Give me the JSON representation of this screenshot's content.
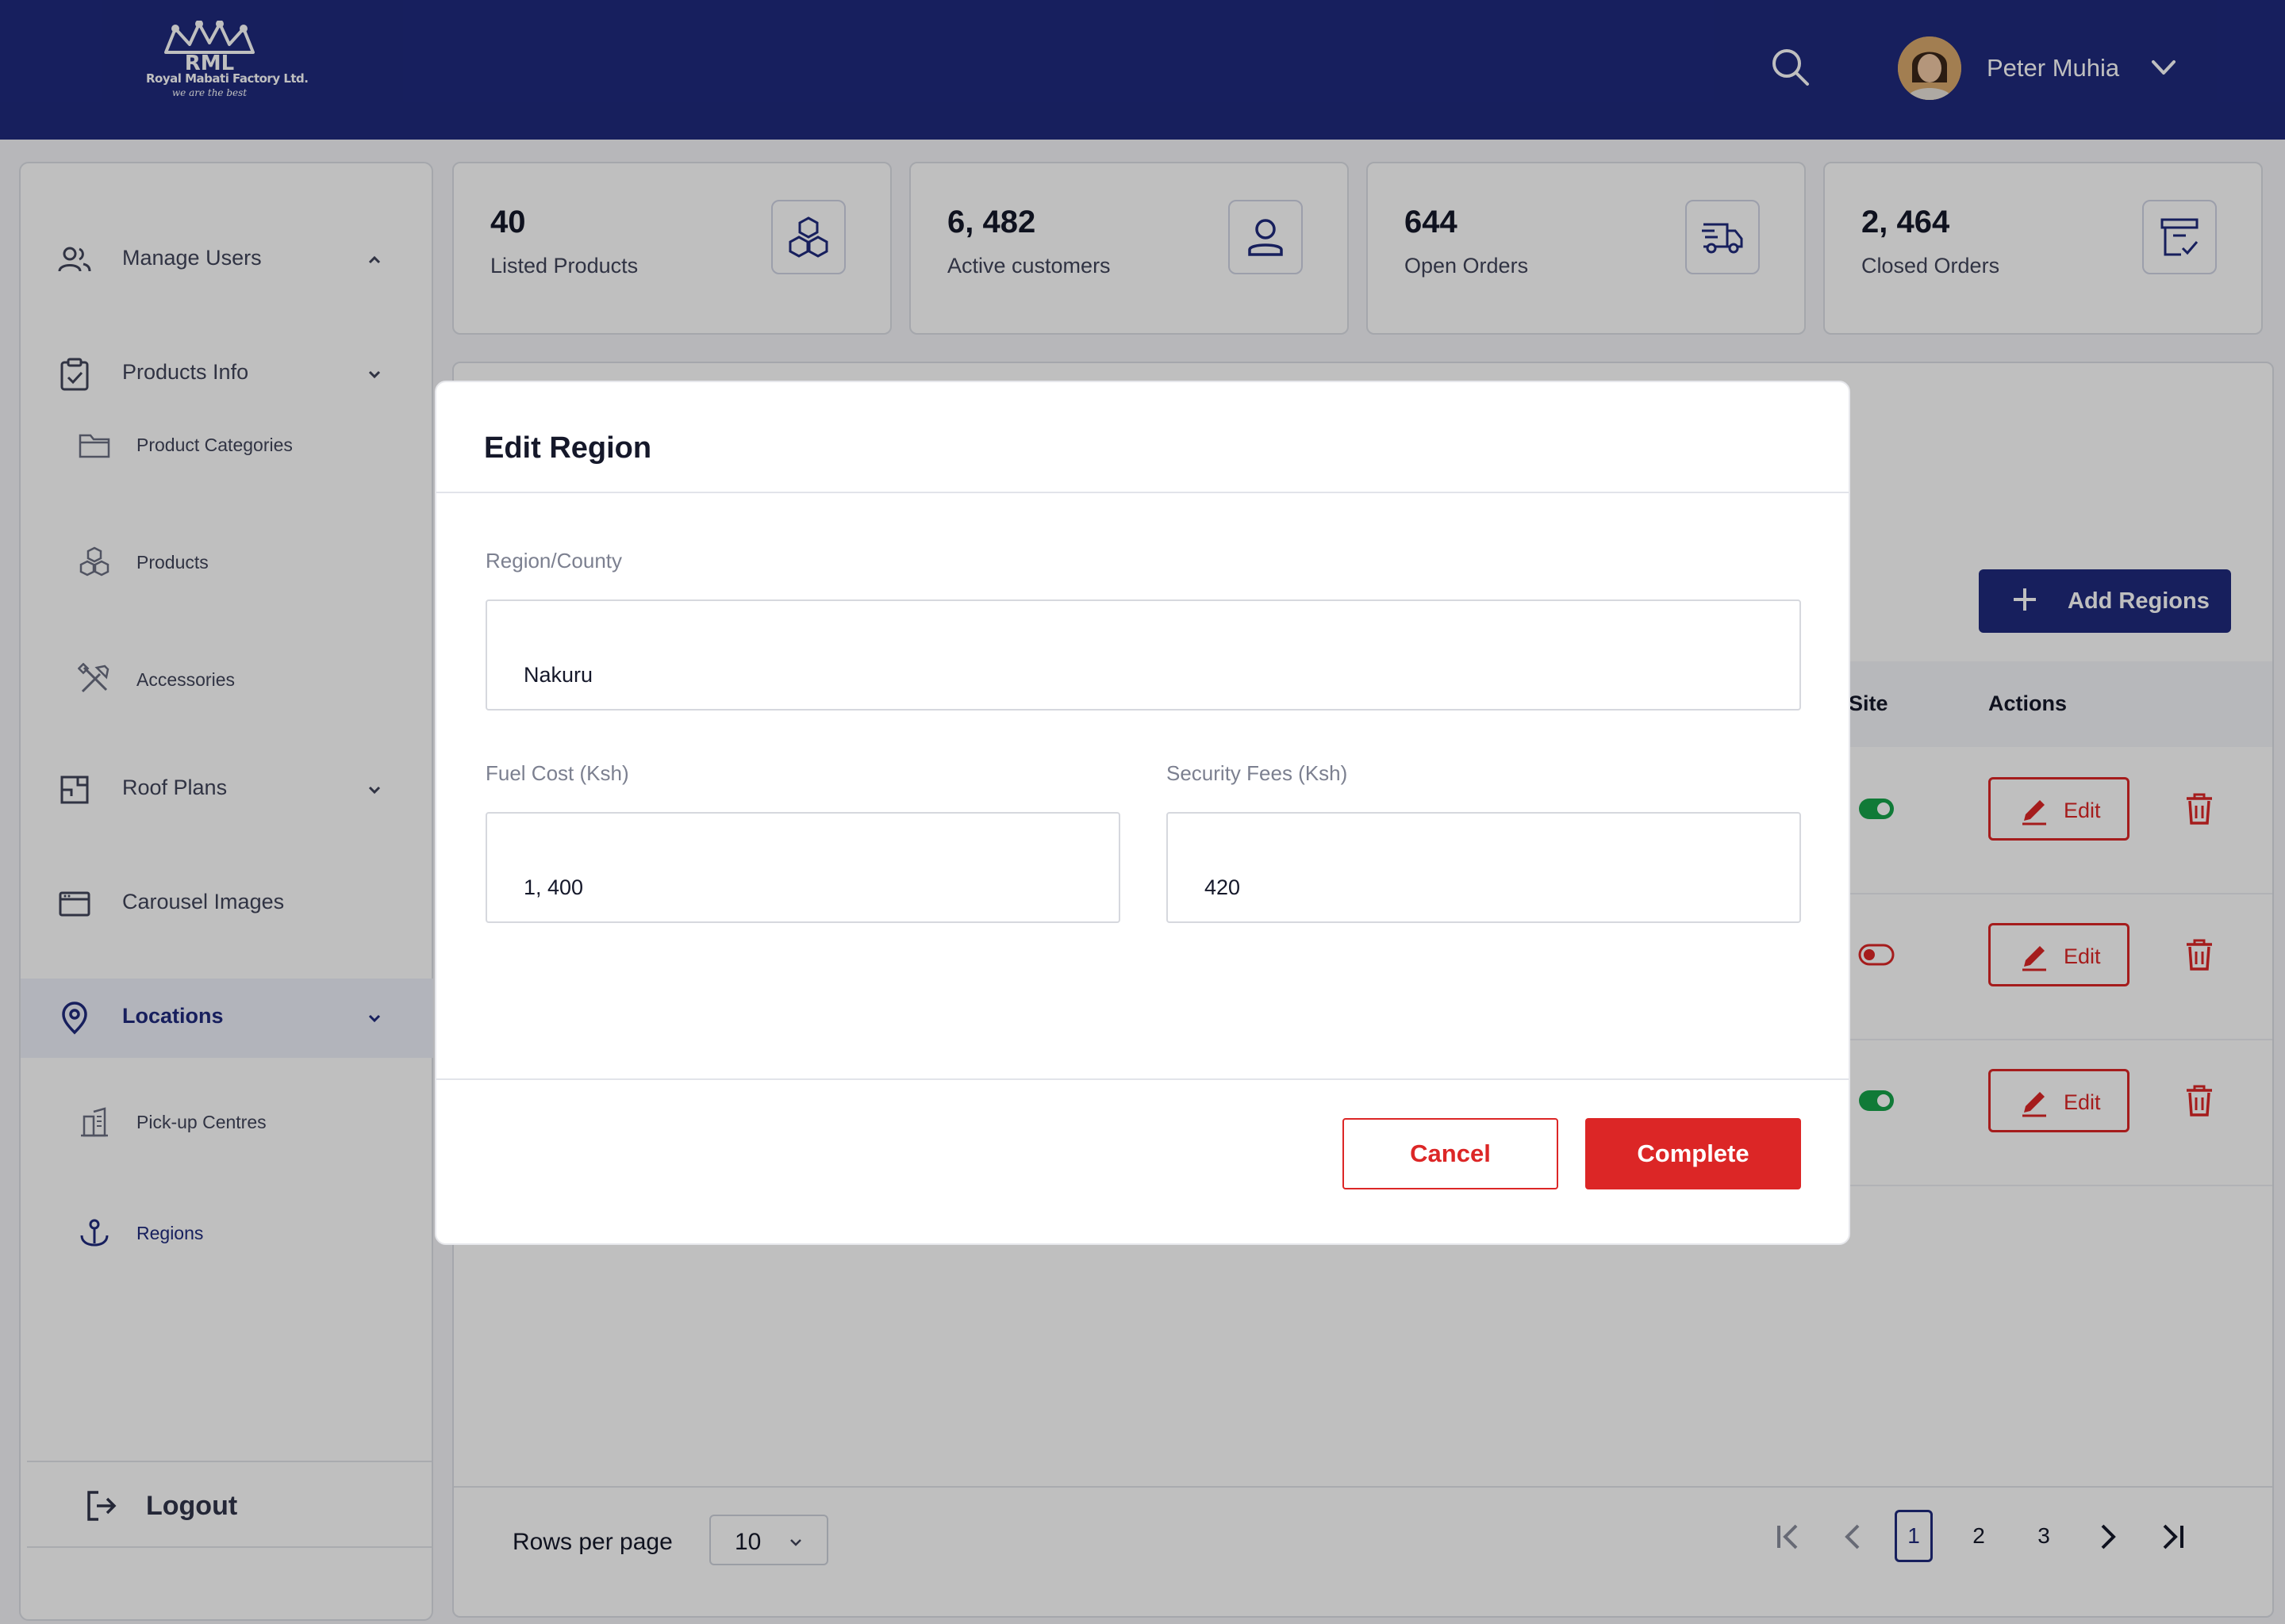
{
  "app": {
    "brand": "Royal Mabati Factory Ltd.",
    "brand_abbr": "RML",
    "tagline": "we are the best"
  },
  "header": {
    "user_name": "Peter Muhia",
    "icons": [
      "search-icon",
      "avatar",
      "chevron-down-icon"
    ]
  },
  "sidebar": {
    "items": [
      {
        "label": "Manage Users",
        "icon": "users-icon"
      },
      {
        "label": "Products Info",
        "icon": "clipboard-check-icon"
      },
      {
        "label": "Product Categories",
        "icon": "folder-icon"
      },
      {
        "label": "Products",
        "icon": "cubes-icon"
      },
      {
        "label": "Accessories",
        "icon": "tools-icon"
      },
      {
        "label": "Roof Plans",
        "icon": "floor-plan-icon"
      },
      {
        "label": "Carousel Images",
        "icon": "browser-window-icon"
      },
      {
        "label": "Locations",
        "icon": "map-pin-icon"
      },
      {
        "label": "Pick-up Centres",
        "icon": "building-icon"
      },
      {
        "label": "Regions",
        "icon": "anchor-pin-icon"
      }
    ],
    "logout_label": "Logout"
  },
  "stats": [
    {
      "value": "40",
      "label": "Listed Products",
      "icon": "cubes-icon"
    },
    {
      "value": "6, 482",
      "label": "Active customers",
      "icon": "user-icon"
    },
    {
      "value": "644",
      "label": "Open Orders",
      "icon": "delivery-truck-icon"
    },
    {
      "value": "2, 464",
      "label": "Closed Orders",
      "icon": "archive-check-icon"
    }
  ],
  "regions_table": {
    "add_button": "Add Regions",
    "columns": [
      "Site",
      "Actions"
    ],
    "rows": [
      {
        "site_active": true,
        "edit_label": "Edit"
      },
      {
        "site_active": false,
        "edit_label": "Edit"
      },
      {
        "site_active": true,
        "edit_label": "Edit"
      }
    ],
    "colors": {
      "toggle_on": "#16a34a",
      "toggle_off": "#dc2626"
    }
  },
  "pagination": {
    "rows_per_page_label": "Rows per page",
    "rows_per_page_value": "10",
    "pages": [
      "1",
      "2",
      "3"
    ],
    "current_page": "1"
  },
  "modal": {
    "title": "Edit Region",
    "region_label": "Region/County",
    "region_value": "Nakuru",
    "fuel_label": "Fuel Cost (Ksh)",
    "fuel_value": "1, 400",
    "security_label": "Security Fees (Ksh)",
    "security_value": "420",
    "cancel_label": "Cancel",
    "complete_label": "Complete"
  },
  "colors": {
    "primary": "#1f2a7d",
    "danger": "#dc2626"
  }
}
